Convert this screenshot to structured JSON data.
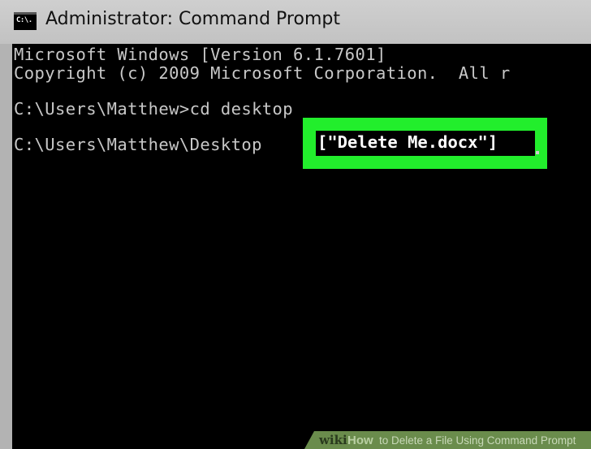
{
  "window": {
    "title": "Administrator: Command Prompt",
    "icon": "cmd-icon",
    "icon_text": "C:\\."
  },
  "console": {
    "lines": [
      "Microsoft Windows [Version 6.1.7601]",
      "Copyright (c) 2009 Microsoft Corporation.  All r",
      "",
      "C:\\Users\\Matthew>cd desktop",
      "",
      "C:\\Users\\Matthew\\Desktop"
    ],
    "highlighted_input": "[\"Delete Me.docx\"]",
    "highlight_color": "#22ee2c"
  },
  "banner": {
    "wiki": "wiki",
    "how": "How",
    "text": "to Delete a File Using Command Prompt",
    "color": "#6a8c4c"
  }
}
